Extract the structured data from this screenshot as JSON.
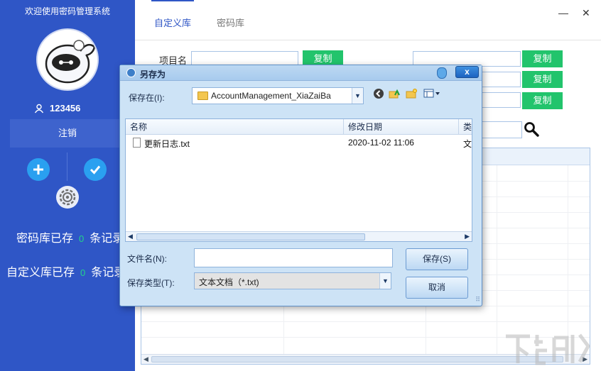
{
  "sidebar": {
    "welcome": "欢迎使用密码管理系统",
    "username": "123456",
    "logout_label": "注销",
    "stats": [
      {
        "prefix": "密码库已存",
        "count": "0",
        "suffix": "条记录"
      },
      {
        "prefix": "自定义库已存",
        "count": "0",
        "suffix": "条记录"
      }
    ]
  },
  "main": {
    "tabs": [
      {
        "label": "自定义库"
      },
      {
        "label": "密码库"
      }
    ],
    "window": {
      "minimize": "—",
      "close": "✕"
    },
    "form": {
      "item_name_label": "项目名",
      "copy_label": "复制"
    }
  },
  "dialog": {
    "title": "另存为",
    "close": "x",
    "save_in_label": "保存在(I):",
    "save_in_value": "AccountManagement_XiaZaiBa",
    "columns": [
      "名称",
      "修改日期",
      "类型"
    ],
    "files": [
      {
        "name": "更新日志.txt",
        "modified": "2020-11-02 11:06",
        "type": "文本文档"
      }
    ],
    "filename_label": "文件名(N):",
    "filename_value": "",
    "filetype_label": "保存类型(T):",
    "filetype_value": "文本文档（*.txt)",
    "save_button": "保存(S)",
    "cancel_button": "取消"
  },
  "colors": {
    "sidebar_bg": "#2f56c6",
    "accent_green": "#22c46c",
    "count_green": "#22d48a",
    "dialog_bg": "#cde3f6"
  }
}
